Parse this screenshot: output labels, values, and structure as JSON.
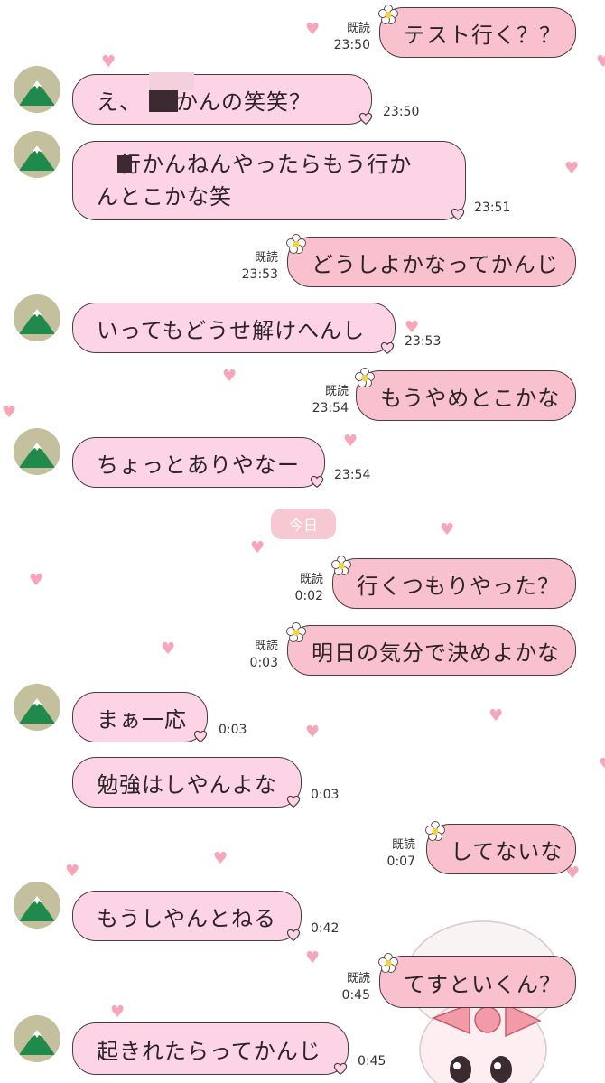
{
  "date_divider": "今日",
  "read_label": "既読",
  "messages": [
    {
      "id": "m1",
      "side": "out",
      "text": "テスト行く？？",
      "time": "23:50",
      "read": true
    },
    {
      "id": "m2",
      "side": "in",
      "text": "え、　いかんの笑笑？",
      "time": "23:50"
    },
    {
      "id": "m3",
      "side": "in",
      "line1": "　行かんねんやったらもう行か",
      "line2": "んとこかな笑",
      "time": "23:51"
    },
    {
      "id": "m4",
      "side": "out",
      "text": "どうしよかなってかんじ",
      "time": "23:53",
      "read": true
    },
    {
      "id": "m5",
      "side": "in",
      "text": "いってもどうせ解けへんし",
      "time": "23:53"
    },
    {
      "id": "m6",
      "side": "out",
      "text": "もうやめとこかな",
      "time": "23:54",
      "read": true
    },
    {
      "id": "m7",
      "side": "in",
      "text": "ちょっとありやなー",
      "time": "23:54"
    },
    {
      "id": "m8",
      "side": "out",
      "text": "行くつもりやった？",
      "time": "0:02",
      "read": true
    },
    {
      "id": "m9",
      "side": "out",
      "text": "明日の気分で決めよかな",
      "time": "0:03",
      "read": true
    },
    {
      "id": "m10",
      "side": "in",
      "text": "まぁ一応",
      "time": "0:03"
    },
    {
      "id": "m11",
      "side": "in",
      "text": "勉強はしやんよな",
      "time": "0:03"
    },
    {
      "id": "m12",
      "side": "out",
      "text": "してないな",
      "time": "0:07",
      "read": true
    },
    {
      "id": "m13",
      "side": "in",
      "text": "もうしやんとねる",
      "time": "0:42"
    },
    {
      "id": "m14",
      "side": "out",
      "text": "てすといくん？",
      "time": "0:45",
      "read": true
    },
    {
      "id": "m15",
      "side": "in",
      "text": "起きれたらってかんじ",
      "time": "0:45"
    }
  ],
  "colors": {
    "incoming_bubble": "#fdd3e6",
    "outgoing_bubble": "#f9c1cd",
    "heart": "#f7a6b9",
    "avatar_mountain": "#1f8a4c"
  },
  "icons": [
    "mountain-avatar-icon",
    "heart-icon",
    "flower-icon"
  ]
}
